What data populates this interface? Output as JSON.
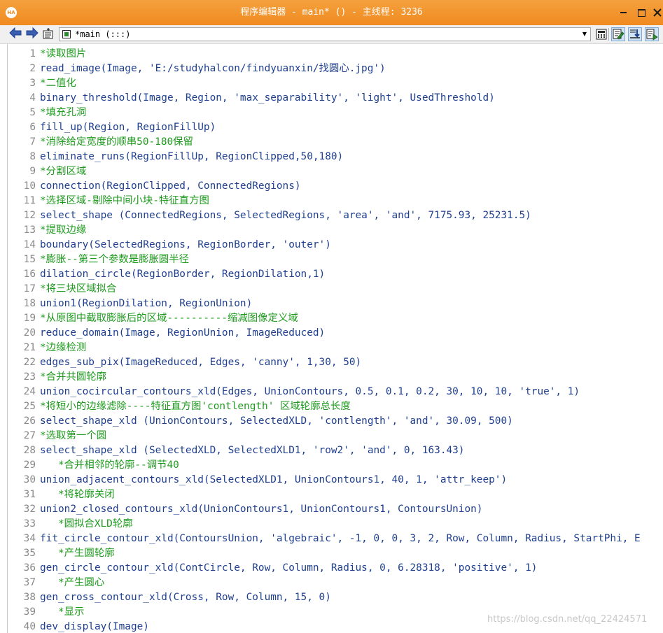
{
  "window": {
    "title": "程序编辑器 - main* () - 主线程: 3236",
    "app_badge": "HA",
    "accent_color": "#f08a1f"
  },
  "toolbar": {
    "back_icon": "back-arrow-icon",
    "forward_icon": "forward-arrow-icon",
    "procedure_selector": "*main (:::)"
  },
  "editor": {
    "comment_color": "#1e9a1e",
    "code_color": "#1f3f8f",
    "lines": [
      {
        "no": "1",
        "type": "comment",
        "text": "*读取图片"
      },
      {
        "no": "2",
        "type": "code",
        "text": "read_image(Image, 'E:/studyhalcon/findyuanxin/找圆心.jpg')"
      },
      {
        "no": "3",
        "type": "comment",
        "text": "*二值化"
      },
      {
        "no": "4",
        "type": "code",
        "text": "binary_threshold(Image, Region, 'max_separability', 'light', UsedThreshold)"
      },
      {
        "no": "5",
        "type": "comment",
        "text": "*填充孔洞"
      },
      {
        "no": "6",
        "type": "code",
        "text": "fill_up(Region, RegionFillUp)"
      },
      {
        "no": "7",
        "type": "comment",
        "text": "*消除给定宽度的顺串50-180保留"
      },
      {
        "no": "8",
        "type": "code",
        "text": "eliminate_runs(RegionFillUp, RegionClipped,50,180)"
      },
      {
        "no": "9",
        "type": "comment",
        "text": "*分割区域"
      },
      {
        "no": "10",
        "type": "code",
        "text": "connection(RegionClipped, ConnectedRegions)"
      },
      {
        "no": "11",
        "type": "comment",
        "text": "*选择区域-剔除中间小块-特征直方图"
      },
      {
        "no": "12",
        "type": "code",
        "text": "select_shape (ConnectedRegions, SelectedRegions, 'area', 'and', 7175.93, 25231.5)"
      },
      {
        "no": "13",
        "type": "comment",
        "text": "*提取边缘"
      },
      {
        "no": "14",
        "type": "code",
        "text": "boundary(SelectedRegions, RegionBorder, 'outer')"
      },
      {
        "no": "15",
        "type": "comment",
        "text": "*膨胀--第三个参数是膨胀圆半径"
      },
      {
        "no": "16",
        "type": "code",
        "text": "dilation_circle(RegionBorder, RegionDilation,1)"
      },
      {
        "no": "17",
        "type": "comment",
        "text": "*将三块区域拟合"
      },
      {
        "no": "18",
        "type": "code",
        "text": "union1(RegionDilation, RegionUnion)"
      },
      {
        "no": "19",
        "type": "comment",
        "text": "*从原图中截取膨胀后的区域----------缩减图像定义域"
      },
      {
        "no": "20",
        "type": "code",
        "text": "reduce_domain(Image, RegionUnion, ImageReduced)"
      },
      {
        "no": "21",
        "type": "comment",
        "text": "*边缘检测"
      },
      {
        "no": "22",
        "type": "code",
        "text": "edges_sub_pix(ImageReduced, Edges, 'canny', 1,30, 50)"
      },
      {
        "no": "23",
        "type": "comment",
        "text": "*合并共圆轮廓"
      },
      {
        "no": "24",
        "type": "code",
        "text": "union_cocircular_contours_xld(Edges, UnionContours, 0.5, 0.1, 0.2, 30, 10, 10, 'true', 1)"
      },
      {
        "no": "25",
        "type": "comment",
        "text": "*将短小的边缘滤除----特征直方图'contlength' 区域轮廓总长度"
      },
      {
        "no": "26",
        "type": "code",
        "text": "select_shape_xld (UnionContours, SelectedXLD, 'contlength', 'and', 30.09, 500)"
      },
      {
        "no": "27",
        "type": "comment",
        "text": "*选取第一个圆"
      },
      {
        "no": "28",
        "type": "code",
        "text": "select_shape_xld (SelectedXLD, SelectedXLD1, 'row2', 'and', 0, 163.43)"
      },
      {
        "no": "29",
        "type": "comment",
        "text": "   *合并相邻的轮廓--调节40"
      },
      {
        "no": "30",
        "type": "code",
        "text": "union_adjacent_contours_xld(SelectedXLD1, UnionContours1, 40, 1, 'attr_keep')"
      },
      {
        "no": "31",
        "type": "comment",
        "text": "   *将轮廓关闭"
      },
      {
        "no": "32",
        "type": "code",
        "text": "union2_closed_contours_xld(UnionContours1, UnionContours1, ContoursUnion)"
      },
      {
        "no": "33",
        "type": "comment",
        "text": "   *圆拟合XLD轮廓"
      },
      {
        "no": "34",
        "type": "code",
        "text": "fit_circle_contour_xld(ContoursUnion, 'algebraic', -1, 0, 0, 3, 2, Row, Column, Radius, StartPhi, E"
      },
      {
        "no": "35",
        "type": "comment",
        "text": "   *产生圆轮廓"
      },
      {
        "no": "36",
        "type": "code",
        "text": "gen_circle_contour_xld(ContCircle, Row, Column, Radius, 0, 6.28318, 'positive', 1)"
      },
      {
        "no": "37",
        "type": "comment",
        "text": "   *产生圆心"
      },
      {
        "no": "38",
        "type": "code",
        "text": "gen_cross_contour_xld(Cross, Row, Column, 15, 0)"
      },
      {
        "no": "39",
        "type": "comment",
        "text": "   *显示"
      },
      {
        "no": "40",
        "type": "code",
        "text": "dev_display(Image)"
      }
    ]
  },
  "watermark": "https://blog.csdn.net/qq_22424571"
}
